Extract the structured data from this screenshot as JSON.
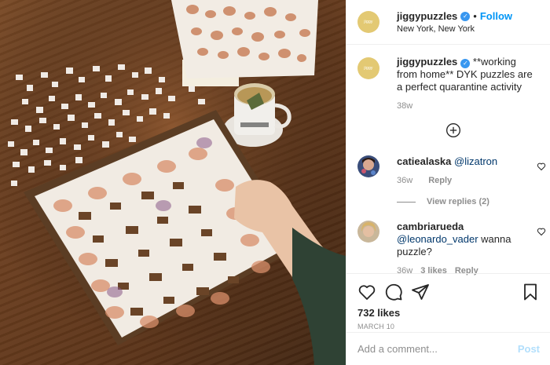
{
  "post": {
    "username": "jiggypuzzles",
    "follow_label": "Follow",
    "dot": "•",
    "location": "New York, New York",
    "caption": "**working from home** DYK puzzles are a perfect quarantine activity",
    "caption_time": "38w",
    "avatar_text": "jiggy"
  },
  "comments": [
    {
      "username": "catiealaska",
      "mention": "@lizatron",
      "text": "",
      "time": "36w",
      "likes": "",
      "reply_label": "Reply",
      "view_replies": "View replies (2)"
    },
    {
      "username": "cambriarueda",
      "mention": "@leonardo_vader",
      "text": "wanna puzzle?",
      "time": "36w",
      "likes": "3 likes",
      "reply_label": "Reply"
    }
  ],
  "footer": {
    "likes": "732 likes",
    "date": "MARCH 10",
    "comment_placeholder": "Add a comment...",
    "post_label": "Post"
  },
  "icons": {
    "like": "heart-icon",
    "comment": "comment-icon",
    "share": "paper-plane-icon",
    "save": "bookmark-icon",
    "load_more": "plus-circle-icon"
  },
  "colors": {
    "link": "#0095f6",
    "verified": "#3897f0",
    "muted": "#8e8e8e",
    "avatar": "#e3c973"
  }
}
